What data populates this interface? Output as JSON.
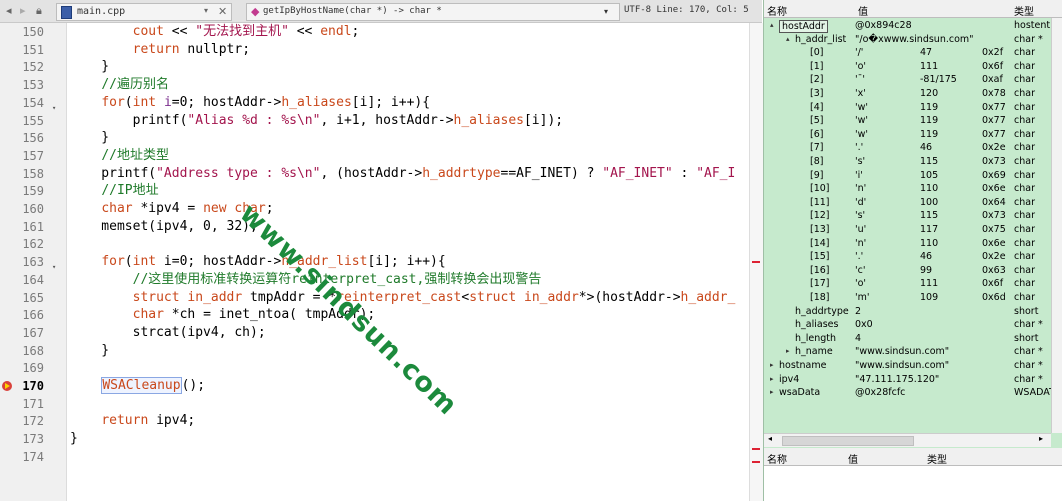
{
  "toolbar": {
    "file_tab": "main.cpp",
    "function_tab": "getIpByHostName(char *) -> char *",
    "status": "UTF-8 Line: 170, Col: 5"
  },
  "code_lines": [
    {
      "n": "150",
      "html": "        <span class=\"kw\">cout</span> &lt;&lt; <span class=\"str\">\"无法找到主机\"</span> &lt;&lt; <span class=\"kw\">endl</span>;"
    },
    {
      "n": "151",
      "html": "        <span class=\"kw\">return</span> nullptr;"
    },
    {
      "n": "152",
      "html": "    }"
    },
    {
      "n": "153",
      "html": "    <span class=\"cmt\">//遍历别名</span>"
    },
    {
      "n": "154",
      "fold": true,
      "html": "    <span class=\"kw\">for</span>(<span class=\"kw\">int</span> <span class=\"var\">i</span>=0; hostAddr-&gt;<span class=\"kw\">h_aliases</span>[i]; i++){"
    },
    {
      "n": "155",
      "html": "        printf(<span class=\"str\">\"Alias %d : %s\\n\"</span>, i+1, hostAddr-&gt;<span class=\"kw\">h_aliases</span>[i]);"
    },
    {
      "n": "156",
      "html": "    }"
    },
    {
      "n": "157",
      "html": "    <span class=\"cmt\">//地址类型</span>"
    },
    {
      "n": "158",
      "html": "    printf(<span class=\"str\">\"Address type : %s\\n\"</span>, (hostAddr-&gt;<span class=\"kw\">h_addrtype</span>==AF_INET) ? <span class=\"str\">\"AF_INET\"</span> : <span class=\"str\">\"AF_I</span>"
    },
    {
      "n": "159",
      "html": "    <span class=\"cmt\">//IP地址</span>"
    },
    {
      "n": "160",
      "html": "    <span class=\"kw\">char</span> *ipv4 = <span class=\"kw\">new</span> <span class=\"kw\">char</span>;"
    },
    {
      "n": "161",
      "html": "    memset(ipv4, 0, 32);"
    },
    {
      "n": "162",
      "html": ""
    },
    {
      "n": "163",
      "fold": true,
      "html": "    <span class=\"kw\">for</span>(<span class=\"kw\">int</span> i=0; hostAddr-&gt;<span class=\"kw\">h_addr_list</span>[i]; i++){"
    },
    {
      "n": "164",
      "html": "        <span class=\"cmt\">//这里使用标准转换运算符reinterpret_cast,强制转换会出现警告</span>"
    },
    {
      "n": "165",
      "html": "        <span class=\"kw\">struct</span> <span class=\"kw\">in_addr</span> tmpAddr = *<span class=\"kw\">reinterpret_cast</span>&lt;<span class=\"kw\">struct</span> <span class=\"kw\">in_addr</span>*&gt;(hostAddr-&gt;<span class=\"kw\">h_addr_</span>"
    },
    {
      "n": "166",
      "html": "        <span class=\"kw\">char</span> *ch = inet_ntoa( tmpAddr);"
    },
    {
      "n": "167",
      "html": "        strcat(ipv4, ch);"
    },
    {
      "n": "168",
      "html": "    }"
    },
    {
      "n": "169",
      "html": ""
    },
    {
      "n": "170",
      "current": true,
      "html": "    <span class=\"kw hl\">WSACleanup</span>();"
    },
    {
      "n": "171",
      "html": ""
    },
    {
      "n": "172",
      "html": "    <span class=\"kw\">return</span> ipv4;"
    },
    {
      "n": "173",
      "html": "}"
    },
    {
      "n": "174",
      "html": ""
    }
  ],
  "watermark": "www.sindsun.com",
  "watch": {
    "headers": {
      "name": "名称",
      "value": "值",
      "type": "类型"
    },
    "rows": [
      {
        "ind": 0,
        "tri": "▴",
        "name": "hostAddr",
        "value": "@0x894c28",
        "type": "hostent",
        "selected": true
      },
      {
        "ind": 1,
        "tri": "▴",
        "name": "h_addr_list",
        "value": "\"/o�xwww.sindsun.com\"",
        "type": "char *"
      },
      {
        "ind": 2,
        "name": "[0]",
        "value": "'/'",
        "dec": "47",
        "hex": "0x2f",
        "type": "char"
      },
      {
        "ind": 2,
        "name": "[1]",
        "value": "'o'",
        "dec": "111",
        "hex": "0x6f",
        "type": "char"
      },
      {
        "ind": 2,
        "name": "[2]",
        "value": "'¯'",
        "dec": "-81/175",
        "hex": "0xaf",
        "type": "char"
      },
      {
        "ind": 2,
        "name": "[3]",
        "value": "'x'",
        "dec": "120",
        "hex": "0x78",
        "type": "char"
      },
      {
        "ind": 2,
        "name": "[4]",
        "value": "'w'",
        "dec": "119",
        "hex": "0x77",
        "type": "char"
      },
      {
        "ind": 2,
        "name": "[5]",
        "value": "'w'",
        "dec": "119",
        "hex": "0x77",
        "type": "char"
      },
      {
        "ind": 2,
        "name": "[6]",
        "value": "'w'",
        "dec": "119",
        "hex": "0x77",
        "type": "char"
      },
      {
        "ind": 2,
        "name": "[7]",
        "value": "'.'",
        "dec": "46",
        "hex": "0x2e",
        "type": "char"
      },
      {
        "ind": 2,
        "name": "[8]",
        "value": "'s'",
        "dec": "115",
        "hex": "0x73",
        "type": "char"
      },
      {
        "ind": 2,
        "name": "[9]",
        "value": "'i'",
        "dec": "105",
        "hex": "0x69",
        "type": "char"
      },
      {
        "ind": 2,
        "name": "[10]",
        "value": "'n'",
        "dec": "110",
        "hex": "0x6e",
        "type": "char"
      },
      {
        "ind": 2,
        "name": "[11]",
        "value": "'d'",
        "dec": "100",
        "hex": "0x64",
        "type": "char"
      },
      {
        "ind": 2,
        "name": "[12]",
        "value": "'s'",
        "dec": "115",
        "hex": "0x73",
        "type": "char"
      },
      {
        "ind": 2,
        "name": "[13]",
        "value": "'u'",
        "dec": "117",
        "hex": "0x75",
        "type": "char"
      },
      {
        "ind": 2,
        "name": "[14]",
        "value": "'n'",
        "dec": "110",
        "hex": "0x6e",
        "type": "char"
      },
      {
        "ind": 2,
        "name": "[15]",
        "value": "'.'",
        "dec": "46",
        "hex": "0x2e",
        "type": "char"
      },
      {
        "ind": 2,
        "name": "[16]",
        "value": "'c'",
        "dec": "99",
        "hex": "0x63",
        "type": "char"
      },
      {
        "ind": 2,
        "name": "[17]",
        "value": "'o'",
        "dec": "111",
        "hex": "0x6f",
        "type": "char"
      },
      {
        "ind": 2,
        "name": "[18]",
        "value": "'m'",
        "dec": "109",
        "hex": "0x6d",
        "type": "char"
      },
      {
        "ind": 1,
        "name": "h_addrtype",
        "value": "2",
        "type": "short"
      },
      {
        "ind": 1,
        "name": "h_aliases",
        "value": "0x0",
        "type": "char *"
      },
      {
        "ind": 1,
        "name": "h_length",
        "value": "4",
        "type": "short"
      },
      {
        "ind": 1,
        "tri": "▸",
        "name": "h_name",
        "value": "\"www.sindsun.com\"",
        "type": "char *"
      },
      {
        "ind": 0,
        "tri": "▸",
        "name": "hostname",
        "value": "\"www.sindsun.com\"",
        "type": "char *"
      },
      {
        "ind": 0,
        "tri": "▸",
        "name": "ipv4",
        "value": "\"47.111.175.120\"",
        "type": "char *"
      },
      {
        "ind": 0,
        "tri": "▸",
        "name": "wsaData",
        "value": "@0x28fcfc",
        "type": "WSADATA"
      }
    ]
  },
  "locals": {
    "headers": {
      "name": "名称",
      "value": "值",
      "type": "类型"
    }
  }
}
